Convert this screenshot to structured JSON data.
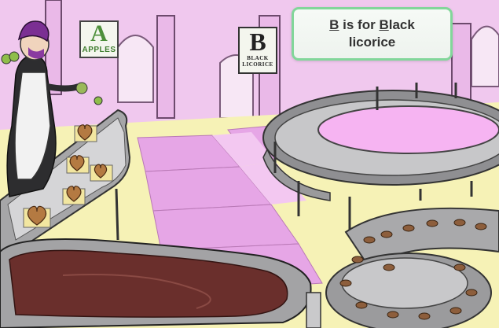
{
  "scene": {
    "sign_a": {
      "letter": "A",
      "word": "APPLES"
    },
    "sign_b": {
      "letter": "B",
      "word_line1": "BLACK",
      "word_line2": "LICORICE"
    },
    "caption": {
      "underlined_1": "B",
      "part_1": " is for ",
      "underlined_2": "B",
      "part_2": "lack",
      "line_2": "licorice"
    }
  },
  "colors": {
    "floor": "#f6f2b6",
    "wall": "#f0c8ee",
    "pink_tile": "#e6a6e6",
    "conveyor": "#a9a9ab",
    "caption_border": "#82d69a",
    "chocolate": "#6a2f2c"
  }
}
